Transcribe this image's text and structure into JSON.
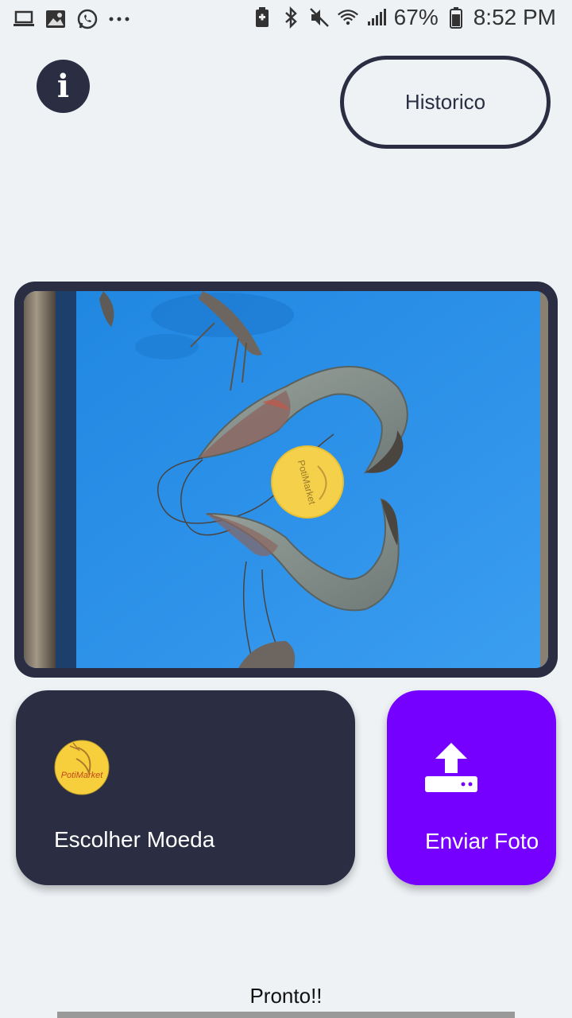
{
  "status_bar": {
    "battery": "67%",
    "time": "8:52 PM",
    "left_icons": [
      "laptop-icon",
      "image-icon",
      "whatsapp-icon",
      "more-icon"
    ],
    "right_icons": [
      "battery-saver-icon",
      "bluetooth-icon",
      "mute-icon",
      "wifi-icon",
      "signal-icon",
      "battery-icon"
    ]
  },
  "header": {
    "info_icon": "i",
    "history_label": "Historico"
  },
  "photo": {
    "coin_text": "PotiMarket"
  },
  "actions": {
    "choose_coin_label": "Escolher Moeda",
    "coin_logo_text": "PotiMarket",
    "send_photo_label": "Enviar Foto",
    "send_icon": "upload-icon"
  },
  "footer": {
    "status": "Pronto!!"
  }
}
